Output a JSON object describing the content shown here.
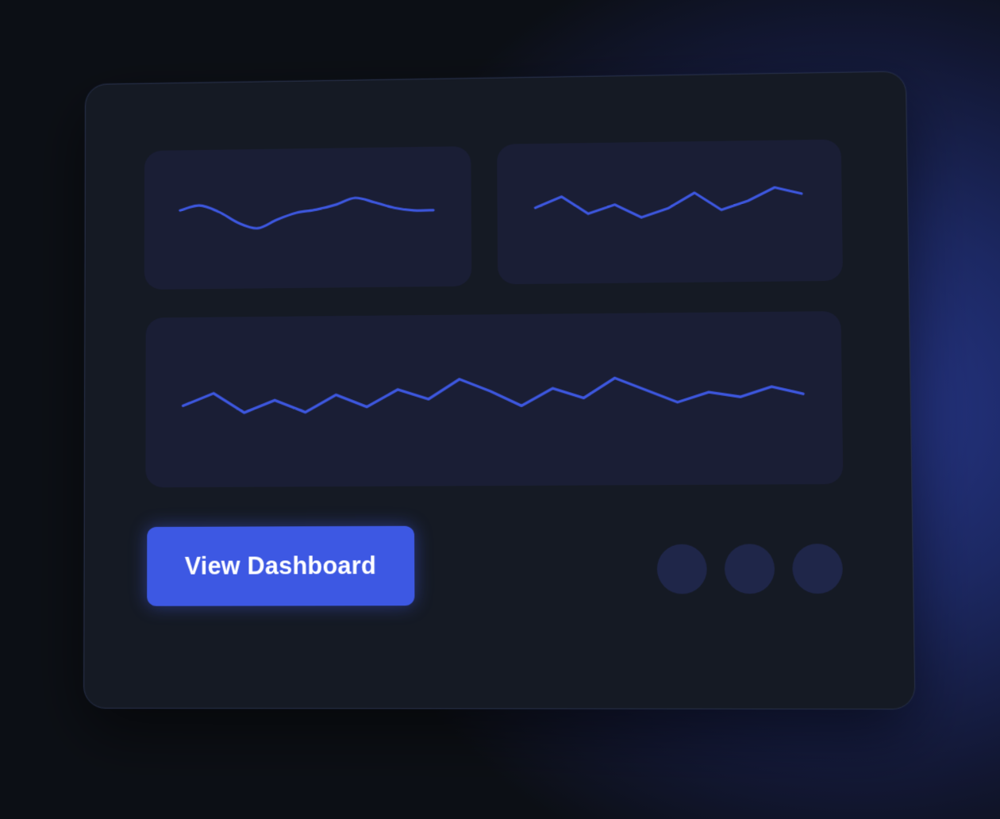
{
  "card": {
    "cta_label": "View Dashboard"
  },
  "sparklines": {
    "top_left": {
      "style": "smooth",
      "values": [
        0.45,
        0.7,
        0.35,
        -0.25,
        -0.55,
        -0.1,
        0.25,
        0.4,
        0.65,
        1.0,
        0.75,
        0.45,
        0.3,
        0.3
      ]
    },
    "top_right": {
      "style": "polyline",
      "values": [
        0.3,
        0.55,
        0.15,
        0.35,
        0.05,
        0.25,
        0.6,
        0.2,
        0.4,
        0.7,
        0.55
      ]
    },
    "main": {
      "style": "polyline",
      "values": [
        0.25,
        0.5,
        0.1,
        0.35,
        0.1,
        0.45,
        0.2,
        0.55,
        0.35,
        0.75,
        0.5,
        0.2,
        0.55,
        0.35,
        0.75,
        0.5,
        0.25,
        0.45,
        0.35,
        0.55,
        0.4
      ]
    }
  },
  "colors": {
    "accent": "#3d58e3",
    "line": "#3d57df",
    "panel": "#1a1e35",
    "card": "#151a24",
    "dot": "#1f2649"
  },
  "pagination_dots": [
    "dot-1",
    "dot-2",
    "dot-3"
  ]
}
